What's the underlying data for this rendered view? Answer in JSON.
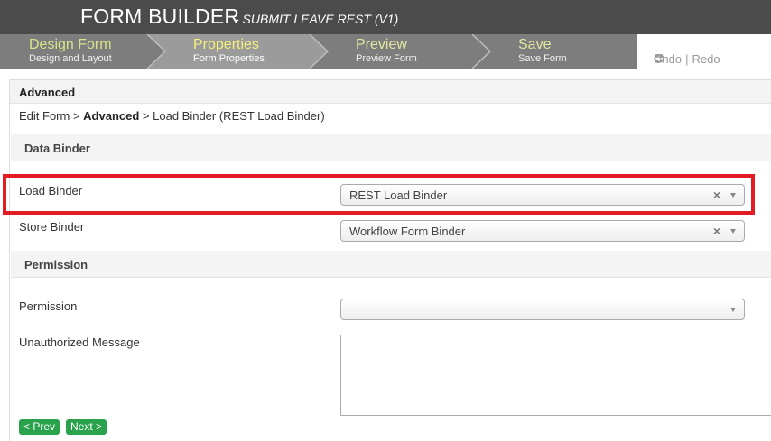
{
  "header": {
    "title": "FORM BUILDER",
    "subtitle": "- SUBMIT LEAVE REST (V1)"
  },
  "steps": [
    {
      "title": "Design Form",
      "subtitle": "Design and Layout"
    },
    {
      "title": "Properties",
      "subtitle": "Form Properties"
    },
    {
      "title": "Preview",
      "subtitle": "Preview Form"
    },
    {
      "title": "Save",
      "subtitle": "Save Form"
    }
  ],
  "toolbar": {
    "undo_label": "Undo",
    "separator": "|",
    "redo_label": "Redo"
  },
  "panel": {
    "title": "Advanced",
    "breadcrumb": {
      "part1": "Edit Form > ",
      "current": "Advanced",
      "part2": " > Load Binder (REST Load Binder)"
    }
  },
  "sections": {
    "data_binder": "Data Binder",
    "permission": "Permission"
  },
  "fields": {
    "load_binder": {
      "label": "Load Binder",
      "value": "REST Load Binder",
      "clear": "×"
    },
    "store_binder": {
      "label": "Store Binder",
      "value": "Workflow Form Binder",
      "clear": "×"
    },
    "permission": {
      "label": "Permission",
      "value": ""
    },
    "unauthorized_message": {
      "label": "Unauthorized Message",
      "value": ""
    }
  },
  "buttons": {
    "prev": "< Prev",
    "next": "Next >"
  },
  "colors": {
    "header_bg": "#4b4b4b",
    "step_active": "#9a9a9a",
    "step_inactive": "#7a7a7a",
    "highlight": "#e31c23",
    "button_green": "#2aa14b"
  }
}
